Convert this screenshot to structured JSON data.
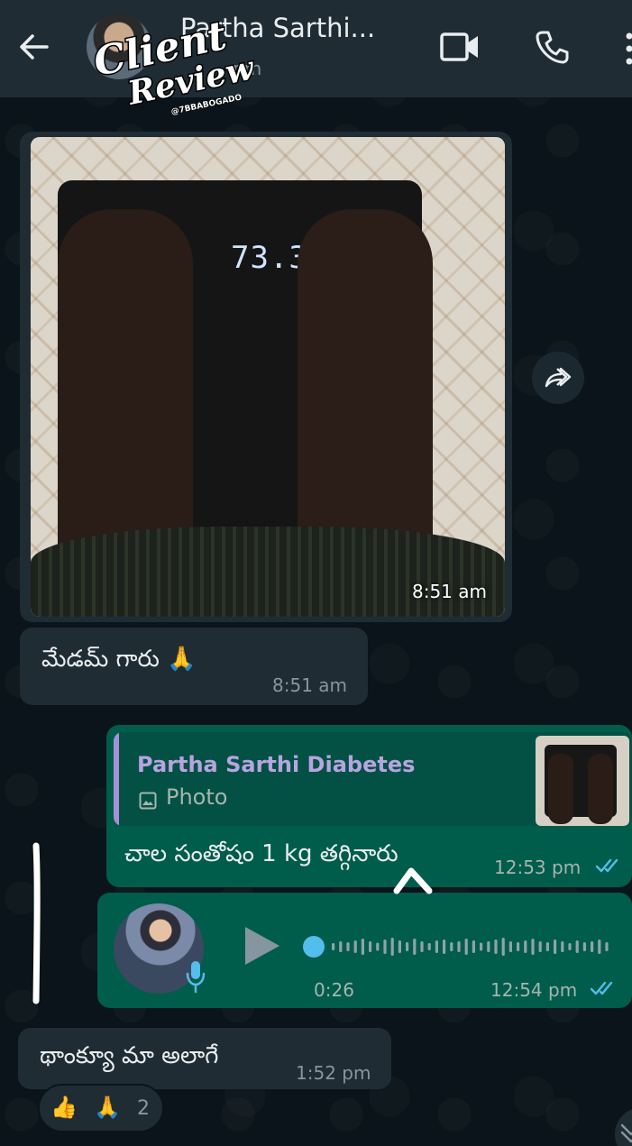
{
  "header": {
    "contact_name": "Partha Sarthi...",
    "status": "pm",
    "back_icon": "arrow-left-icon",
    "video_icon": "video-camera-icon",
    "call_icon": "phone-icon",
    "more_icon": "more-vertical-icon"
  },
  "watermark": {
    "line1": "Client",
    "line2": "Review",
    "handle": "@7BBABOGADO"
  },
  "messages": [
    {
      "type": "image",
      "direction": "incoming",
      "scale_reading": "73.30kg",
      "time": "8:51 am"
    },
    {
      "type": "text",
      "direction": "incoming",
      "text": "మేడమ్ గారు 🙏",
      "time": "8:51 am"
    },
    {
      "type": "reply",
      "direction": "outgoing",
      "quoted_name": "Partha Sarthi Diabetes",
      "quoted_type": "Photo",
      "text": "చాల సంతోషం 1 kg తగ్గినారు",
      "time": "12:53 pm",
      "status": "read"
    },
    {
      "type": "voice",
      "direction": "outgoing",
      "duration": "0:26",
      "time": "12:54 pm",
      "status": "read"
    },
    {
      "type": "text",
      "direction": "incoming",
      "text": "థాంక్యూ మా అలాగే",
      "time": "1:52 pm",
      "reactions": {
        "emoji1": "👍",
        "emoji2": "🙏",
        "count": "2"
      }
    }
  ],
  "colors": {
    "background": "#0b141a",
    "header": "#1f2c34",
    "incoming_bubble": "#1f2c34",
    "outgoing_bubble": "#005c4b",
    "read_ticks": "#53bdeb",
    "quote_name": "#b7a4e0"
  }
}
